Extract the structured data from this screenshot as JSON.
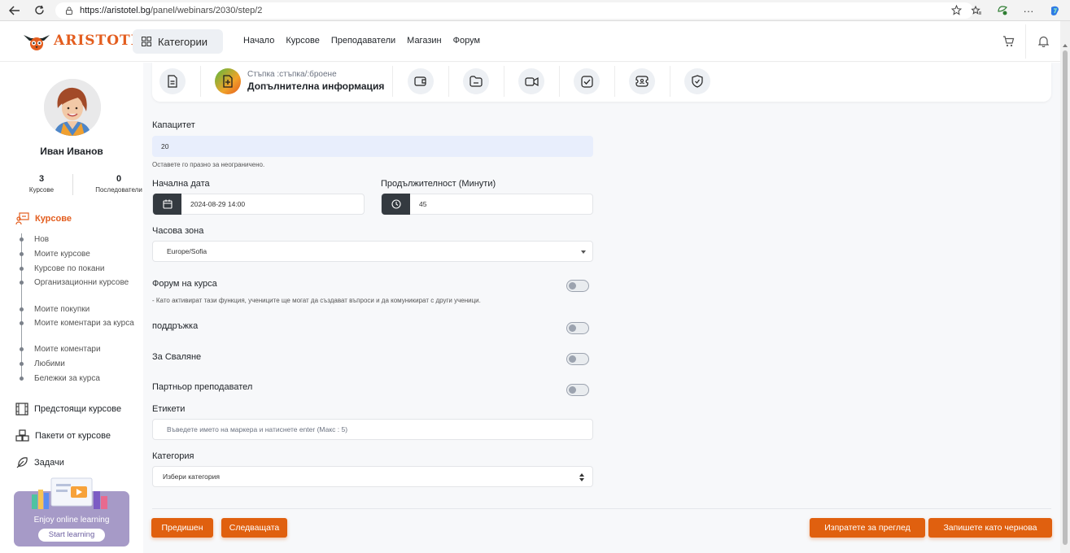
{
  "browser": {
    "url_host": "https://aristotel.bg",
    "url_path": "/panel/webinars/2030/step/2"
  },
  "header": {
    "logo_text": "ARISTOTLE",
    "categories_label": "Категории",
    "nav": [
      "Начало",
      "Курсове",
      "Преподаватели",
      "Магазин",
      "Форум"
    ]
  },
  "sidebar": {
    "user_name": "Иван Иванов",
    "stats": [
      {
        "value": "3",
        "label": "Курсове"
      },
      {
        "value": "0",
        "label": "Последователи"
      }
    ],
    "courses_heading": "Курсове",
    "courses_items": [
      "Нов",
      "Моите курсове",
      "Курсове по покани",
      "Организационни курсове",
      "Моите покупки",
      "Моите коментари за курса",
      "Моите коментари",
      "Любими",
      "Бележки за курса"
    ],
    "other_headings": [
      "Предстоящи курсове",
      "Пакети от курсове",
      "Задачи"
    ],
    "promo": {
      "text": "Enjoy online learning",
      "button": "Start learning"
    }
  },
  "steps": {
    "current_sub": "Стъпка :стъпка/:броене",
    "current_title": "Допълнителна информация"
  },
  "form": {
    "capacity_label": "Капацитет",
    "capacity_value": "20",
    "capacity_hint": "Оставете го празно за неограничено.",
    "start_date_label": "Начална дата",
    "start_date_value": "2024-08-29 14:00",
    "duration_label": "Продължителност (Минути)",
    "duration_value": "45",
    "timezone_label": "Часова зона",
    "timezone_value": "Europe/Sofia",
    "forum_label": "Форум на курса",
    "forum_hint": "- Като активират тази функция, учениците ще могат да създават въпроси и да комуникират с други ученици.",
    "support_label": "поддръжка",
    "download_label": "За Сваляне",
    "partner_label": "Партньор преподавател",
    "tags_label": "Етикети",
    "tags_placeholder": "Въведете името на маркера и натиснете enter (Макс : 5)",
    "category_label": "Категория",
    "category_value": "Избери категория"
  },
  "actions": {
    "prev": "Предишен",
    "next": "Следващата",
    "send_review": "Изпратете за преглед",
    "save_draft": "Запишете като чернова"
  },
  "colors": {
    "accent": "#e0600f",
    "dark": "#343a40",
    "filled_input": "#e8eefc"
  }
}
